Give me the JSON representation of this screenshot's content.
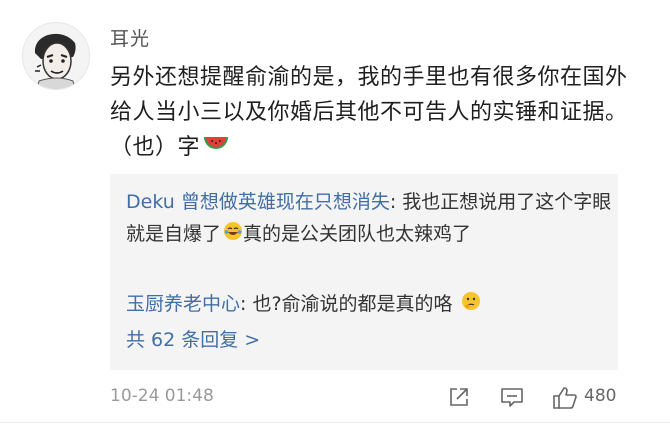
{
  "comment": {
    "username": "耳光",
    "text": "另外还想提醒俞渝的是，我的手里也有很多你在国外给人当小三以及你婚后其他不可告人的实锤和证据。  （也）字",
    "emoji": "watermelon-icon",
    "time": "10-24 01:48",
    "likes": "480"
  },
  "replies": [
    {
      "name": "Deku 曾想做英雄现在只想消失",
      "text": ": 我也正想说用了这个字眼就是自爆了",
      "emoji": "laughing-crying-face-icon",
      "text2": "真的是公关团队也太辣鸡了"
    },
    {
      "name": "玉厨养老中心",
      "text": ": 也?俞渝说的都是真的咯",
      "emoji": "thinking-face-icon"
    }
  ],
  "more_replies": "共 62 条回复 >",
  "colors": {
    "link": "#426ea6",
    "reply_bg": "#f4f4f4",
    "muted": "#9a9a9a"
  }
}
